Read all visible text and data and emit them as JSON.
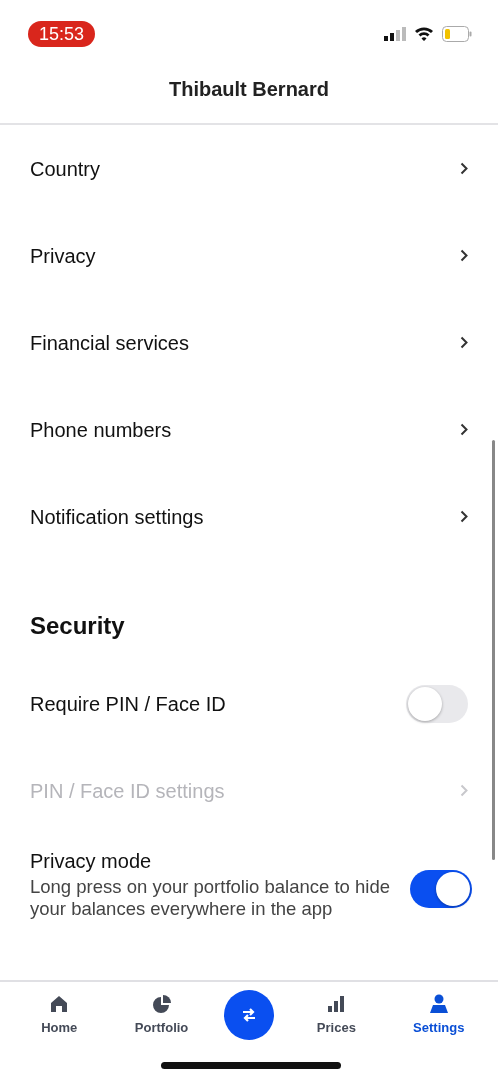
{
  "status_bar": {
    "time": "15:53"
  },
  "header": {
    "title": "Thibault Bernard"
  },
  "settings": [
    {
      "kind": "link",
      "label": "Country",
      "disabled": false
    },
    {
      "kind": "link",
      "label": "Privacy",
      "disabled": false
    },
    {
      "kind": "link",
      "label": "Financial services",
      "disabled": false
    },
    {
      "kind": "link",
      "label": "Phone numbers",
      "disabled": false
    },
    {
      "kind": "link",
      "label": "Notification settings",
      "disabled": false
    },
    {
      "kind": "heading",
      "label": "Security"
    },
    {
      "kind": "toggle",
      "label": "Require PIN / Face ID",
      "on": false
    },
    {
      "kind": "link",
      "label": "PIN / Face ID settings",
      "disabled": true
    },
    {
      "kind": "toggle",
      "label": "Privacy mode",
      "description": "Long press on your portfolio balance to hide your balances everywhere in the app",
      "on": true
    }
  ],
  "tab_bar": [
    {
      "kind": "tab",
      "label": "Home",
      "selected": false
    },
    {
      "kind": "tab",
      "label": "Portfolio",
      "selected": false
    },
    {
      "kind": "action"
    },
    {
      "kind": "tab",
      "label": "Prices",
      "selected": false
    },
    {
      "kind": "tab",
      "label": "Settings",
      "selected": true
    }
  ]
}
